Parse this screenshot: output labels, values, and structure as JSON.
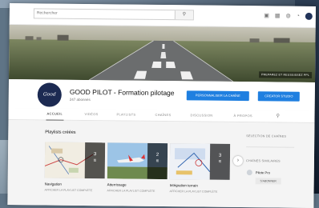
{
  "search": {
    "placeholder": "Rechercher",
    "button_icon": "search-icon"
  },
  "topbar": {
    "icons": [
      "video-camera-icon",
      "apps-grid-icon",
      "messages-icon",
      "notifications-icon",
      "avatar"
    ]
  },
  "banner": {
    "overlay_links": "PREPAREZ ET REUSSISSEZ PPL"
  },
  "channel": {
    "avatar_text": "Good pilot",
    "title": "GOOD PILOT - Formation pilotage",
    "subscribers": "247 abonnés",
    "customize_label": "PERSONNALISER LA CHAÎNE",
    "studio_label": "CREATOR STUDIO"
  },
  "tabs": [
    {
      "label": "ACCUEIL",
      "active": true
    },
    {
      "label": "VIDÉOS"
    },
    {
      "label": "PLAYLISTS"
    },
    {
      "label": "CHAÎNES"
    },
    {
      "label": "DISCUSSION"
    },
    {
      "label": "À PROPOS"
    }
  ],
  "playlists": {
    "section_title": "Playlists créées",
    "items": [
      {
        "title": "Navigation",
        "subtitle": "AFFICHER LA PLAYLIST COMPLÈTE",
        "count": "3"
      },
      {
        "title": "Atterrissage",
        "subtitle": "AFFICHER LA PLAYLIST COMPLÈTE",
        "count": "2"
      },
      {
        "title": "Intégration terrain",
        "subtitle": "AFFICHER LA PLAYLIST COMPLÈTE",
        "count": "3"
      }
    ]
  },
  "sidebar": {
    "selection_heading": "SÉLECTION DE CHAÎNES",
    "similar_heading": "CHAÎNES SIMILAIRES",
    "channel_name": "Pilote Pro",
    "subscribe_label": "S'ABONNER"
  },
  "colors": {
    "accent": "#1f7fe0",
    "avatar_bg": "#1c2a52"
  }
}
